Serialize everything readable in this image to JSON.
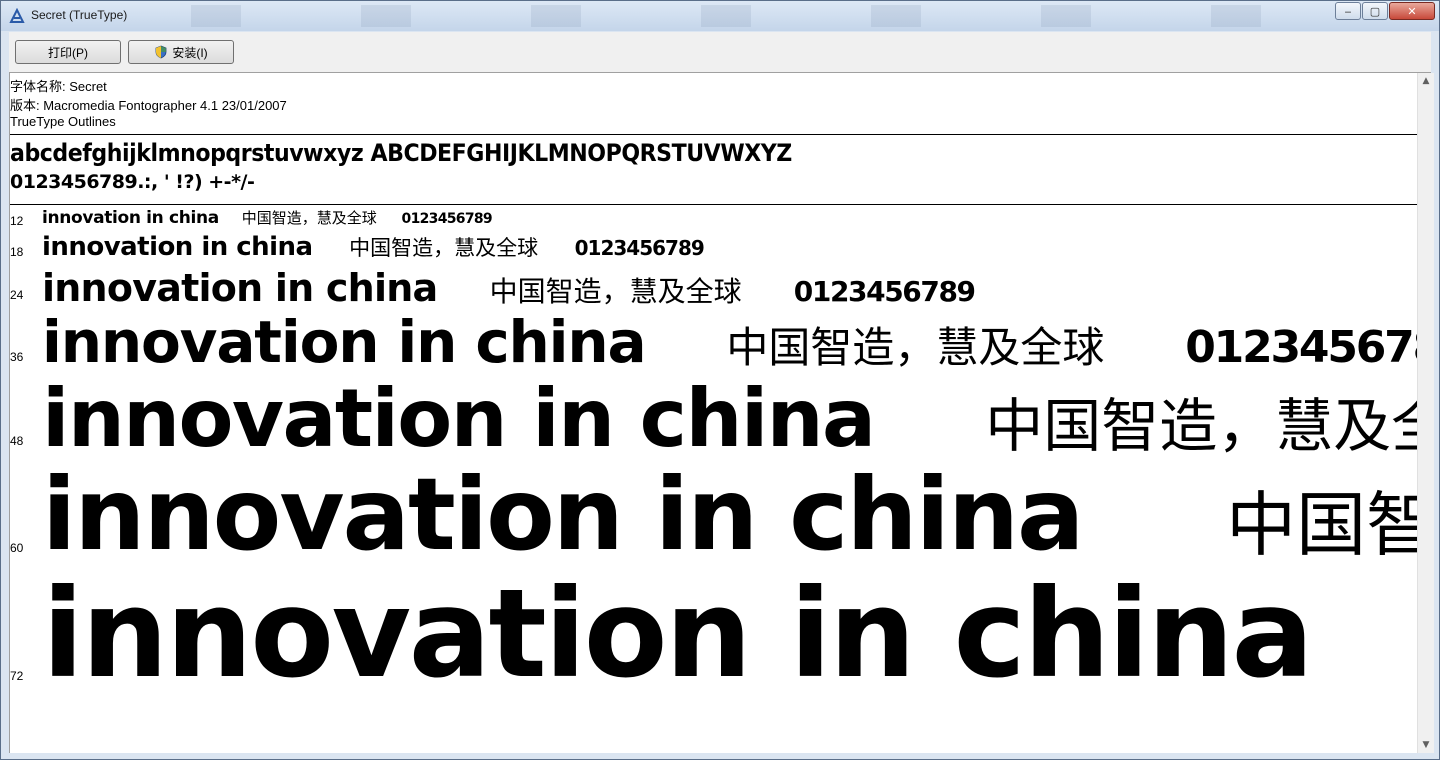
{
  "window": {
    "title": "Secret (TrueType)",
    "minimize_glyph": "‒",
    "maximize_glyph": "▢",
    "close_glyph": "✕"
  },
  "toolbar": {
    "print_label": "打印(P)",
    "install_label": "安装(I)"
  },
  "font_info": {
    "name_line": "字体名称: Secret",
    "version_line": "版本: Macromedia Fontographer 4.1 23/01/2007",
    "outline_line": "TrueType Outlines"
  },
  "charset": {
    "line1": "abcdefghijklmnopqrstuvwxyz ABCDEFGHIJKLMNOPQRSTUVWXYZ",
    "line2": "0123456789.:, ' !?) +-*/-"
  },
  "sample": {
    "latin": "innovation in china",
    "cjk": "中国智造，慧及全球",
    "digits": "0123456789"
  },
  "sizes": [
    "12",
    "18",
    "24",
    "36",
    "48",
    "60",
    "72"
  ],
  "icons": {
    "app": "font-app-icon",
    "shield": "uac-shield-icon"
  }
}
